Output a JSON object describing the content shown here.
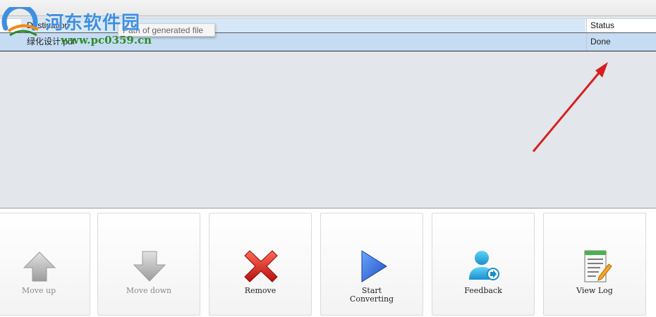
{
  "table": {
    "columns": {
      "destination": "Destination",
      "status": "Status"
    },
    "rows": [
      {
        "destination": "绿化设计.pdf",
        "status": "Done"
      }
    ],
    "tooltip": "Path of generated file"
  },
  "watermark": {
    "text": "河东软件园",
    "url": "www.pc0359.cn"
  },
  "buttons": {
    "move_up": "Move up",
    "move_down": "Move down",
    "remove": "Remove",
    "start_converting": "Start\nConverting",
    "feedback": "Feedback",
    "view_log": "View Log"
  },
  "icons": {
    "move_up": "arrow-up-icon",
    "move_down": "arrow-down-icon",
    "remove": "red-x-icon",
    "start_converting": "play-icon",
    "feedback": "user-feedback-icon",
    "view_log": "log-notepad-icon"
  },
  "colors": {
    "selected_row": "#c5dcf3",
    "annotation_arrow": "#d42020",
    "play_blue": "#1f5fd6"
  }
}
